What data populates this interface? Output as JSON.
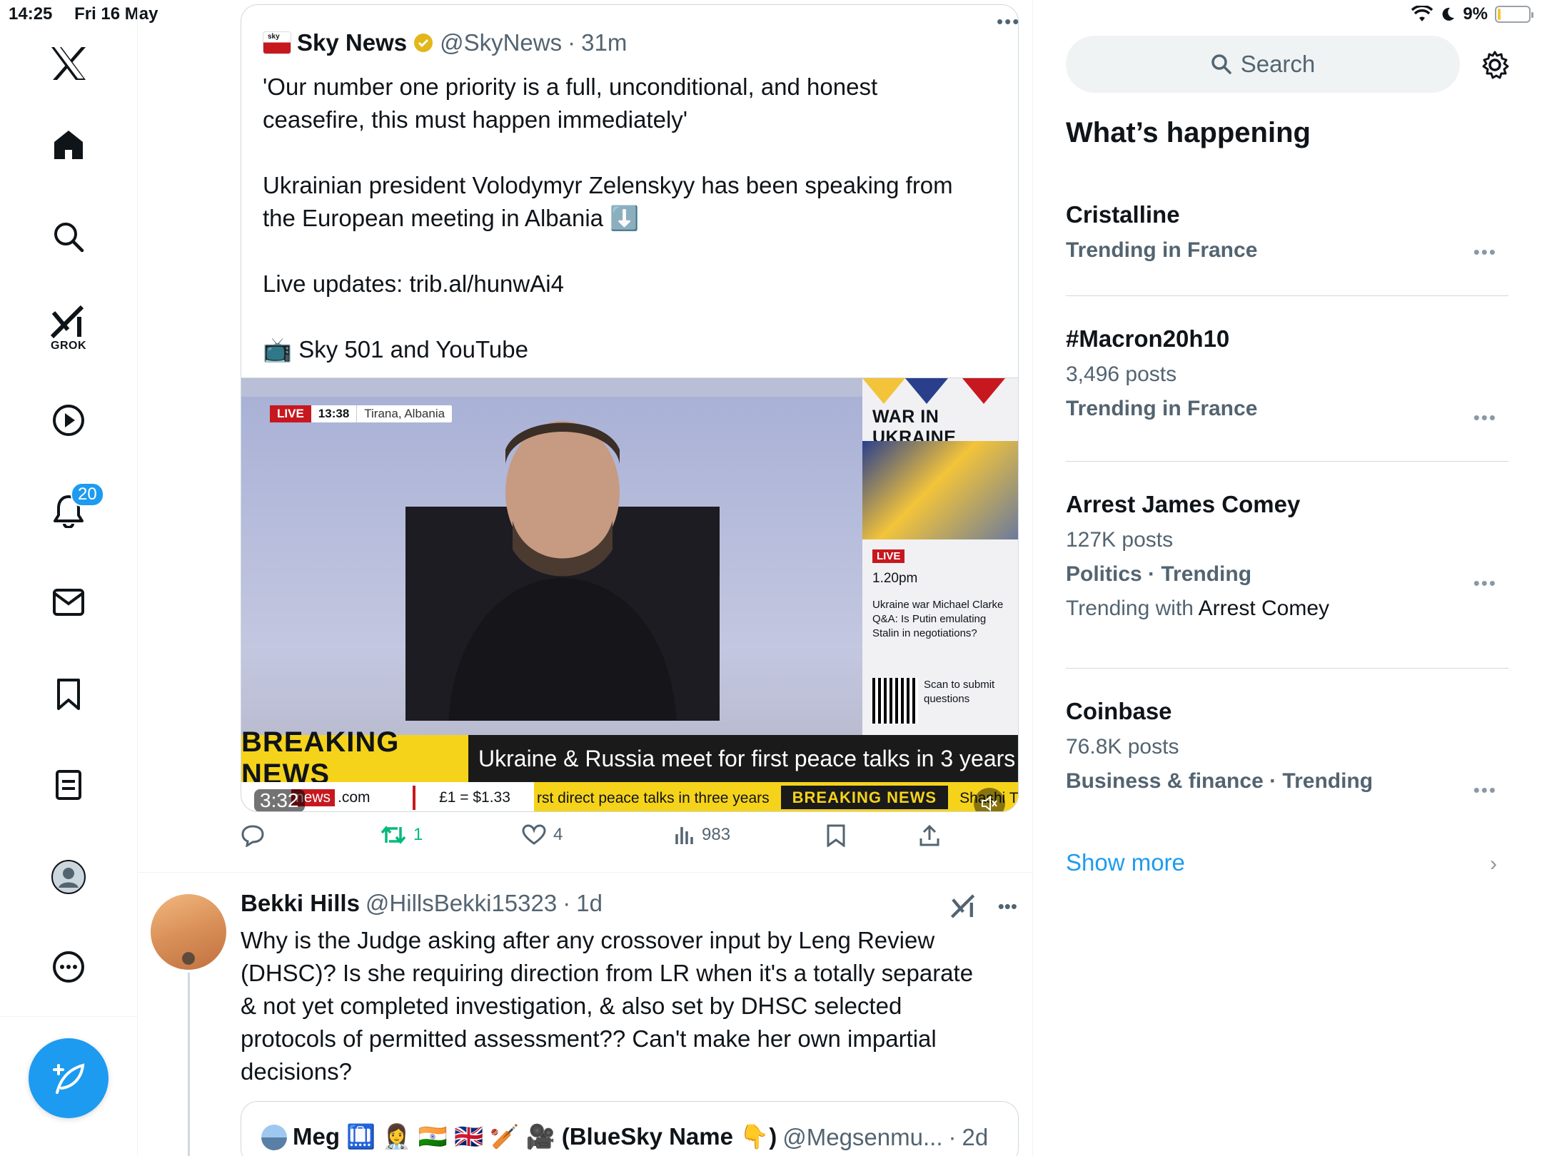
{
  "status_bar": {
    "time": "14:25",
    "date": "Fri 16 May",
    "battery": "9%",
    "battery_level": 0.09
  },
  "nav": {
    "grok_label": "GROK",
    "notifications_count": "20"
  },
  "quoted_tweet": {
    "name": "Sky News",
    "handle": "@SkyNews",
    "sep": "·",
    "time": "31m",
    "lines": [
      "'Our number one priority is a full, unconditional, and honest",
      "ceasefire, this must happen immediately'",
      "Ukrainian president Volodymyr Zelenskyy has been speaking from",
      "the European meeting in Albania ⬇️",
      "Live updates: trib.al/hunwAi4",
      "📺 Sky 501 and YouTube"
    ],
    "video": {
      "live": "LIVE",
      "clock": "13:38",
      "place": "Tirana, Albania",
      "panel_title": "WAR IN UKRAINE",
      "panel_live": "LIVE",
      "panel_time": "1.20pm",
      "panel_desc": "Ukraine war Michael Clarke Q&A: Is Putin emulating Stalin in negotiations?",
      "scan": "Scan to submit questions",
      "breaking": "BREAKING NEWS",
      "headline": "Ukraine & Russia meet for first peace talks in 3 years",
      "ticker_site_a": "news",
      "ticker_site_b": ".com",
      "ticker_fx": "£1 = $1.33",
      "ticker_run": "rst direct peace talks in three years",
      "ticker_bn": "BREAKING NEWS",
      "ticker_tail": "Shashi Th",
      "duration": "3:32"
    },
    "actions": {
      "replies": "",
      "retweets": "1",
      "likes": "4",
      "views": "983"
    }
  },
  "reply": {
    "name": "Bekki Hills",
    "handle": "@HillsBekki15323",
    "sep": "·",
    "time": "1d",
    "lines": [
      "Why is the Judge asking after any crossover input by Leng Review",
      "(DHSC)? Is she requiring  direction from LR when it's a totally separate",
      "& not yet completed investigation, & also set by DHSC selected",
      "protocols of permitted assessment?? Can't make her own impartial",
      "decisions?"
    ],
    "inner_quote": {
      "name": "Meg 🛄 👩‍⚕️ 🇮🇳 🇬🇧 🏏 🎥 (BlueSky Name 👇)",
      "handle": "@Megsenmu...",
      "sep": "·",
      "time": "2d"
    }
  },
  "sidebar": {
    "search_placeholder": "Search",
    "title": "What’s happening",
    "trends": [
      {
        "name": "Cristalline",
        "posts": "",
        "context": "Trending in France",
        "with_prefix": "",
        "with_term": ""
      },
      {
        "name": "#Macron20h10",
        "posts": "3,496 posts",
        "context": "Trending in France",
        "with_prefix": "",
        "with_term": ""
      },
      {
        "name": "Arrest James Comey",
        "posts": "127K posts",
        "context": "Politics · Trending",
        "with_prefix": "Trending with",
        "with_term": "Arrest Comey"
      },
      {
        "name": "Coinbase",
        "posts": "76.8K posts",
        "context": "Business & finance · Trending",
        "with_prefix": "",
        "with_term": ""
      }
    ],
    "show_more": "Show more"
  },
  "colors": {
    "accent": "#1d9bf0",
    "retweet": "#00ba7c",
    "muted": "#536471",
    "breaking_yellow": "#f6d31b",
    "sky_red": "#c7181f"
  }
}
